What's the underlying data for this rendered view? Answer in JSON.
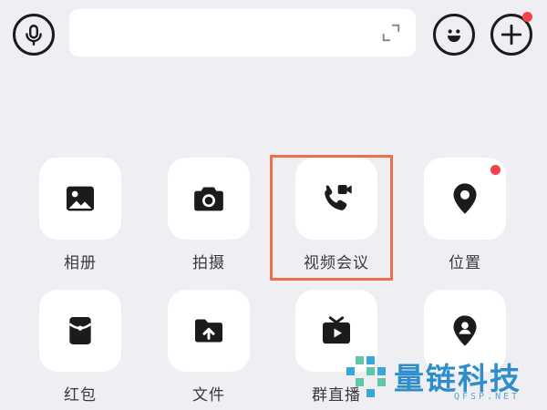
{
  "colors": {
    "background": "#efeff3",
    "icon": "#1b1b1b",
    "badge": "#f2424c",
    "highlight": "#e8714c",
    "watermark": "#2f8ec9"
  },
  "topbar": {
    "voice_icon": "microphone-icon",
    "input_value": "",
    "expand_icon": "expand-icon",
    "emoji_icon": "smiley-icon",
    "plus_icon": "plus-icon"
  },
  "actions": [
    {
      "label": "相册",
      "icon": "image-icon"
    },
    {
      "label": "拍摄",
      "icon": "camera-icon"
    },
    {
      "label": "视频会议",
      "icon": "video-call-icon"
    },
    {
      "label": "位置",
      "icon": "location-pin-icon"
    },
    {
      "label": "红包",
      "icon": "red-packet-icon"
    },
    {
      "label": "文件",
      "icon": "folder-upload-icon"
    },
    {
      "label": "群直播",
      "icon": "tv-live-icon"
    },
    {
      "label": "",
      "icon": "person-pin-icon"
    }
  ],
  "watermark": {
    "name": "量链科技",
    "site": "QFSP.NET"
  }
}
